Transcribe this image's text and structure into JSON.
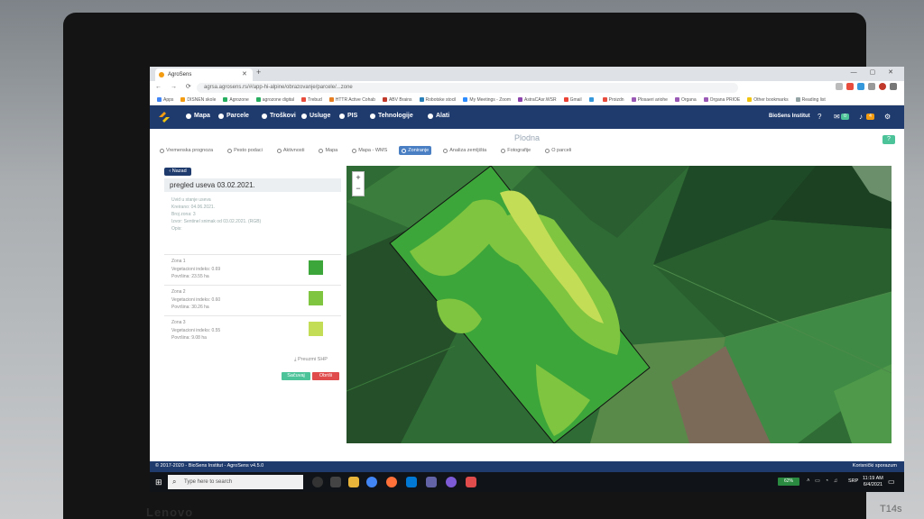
{
  "device": {
    "brand": "Lenovo",
    "model": "T14s"
  },
  "browser": {
    "tab_title": "AgroSens",
    "url": "agrsa.agrosens.rs/#/app-hi-alpine/obrazovanje/parcele/...zone",
    "bookmarks": [
      "Apps",
      "DISNEN skole",
      "Agrozone",
      "agrozone digital",
      "Trebud",
      "HTTR Active Cohab",
      "ABV Brains",
      "Robotske stocil",
      "My Meetings - Zoom",
      "AstraCAsr.WSR",
      "Gmail",
      "",
      "Proizdn",
      "Plosaeri ariohe",
      "Organa",
      "Organa PRIOE",
      "Other bookmarks",
      "Reading list"
    ]
  },
  "app": {
    "nav": [
      "Mapa",
      "Parcele",
      "Troškovi",
      "Usluge",
      "PIS",
      "Tehnologije",
      "Alati"
    ],
    "org": "BioSens Institut",
    "badges": [
      "0",
      "4"
    ],
    "page_title": "Plodna",
    "help": "?",
    "subtabs": [
      "Vremenska prognoza",
      "Pesto podaci",
      "Aktivnosti",
      "Mapa",
      "Mapa - WMS",
      "Zoniranje",
      "Analiza zemljišta",
      "Fotografije",
      "O parceli"
    ],
    "active_subtab": "Zoniranje",
    "back_label": "Nazad",
    "panel_title": "pregled useva 03.02.2021.",
    "info_lines": [
      "Uvid u stanje useva",
      "Kreirano: 04.06.2021.",
      "Broj zona: 3",
      "Izvor: Sentinel snimak od 03.02.2021. (RGB)",
      "Opis:"
    ],
    "zones": [
      {
        "name": "Zona 1",
        "vi": "Vegetacioni indeks: 0.69",
        "area": "Površina: 23.55 ha",
        "color": "#3da63a"
      },
      {
        "name": "Zona 2",
        "vi": "Vegetacioni indeks: 0.60",
        "area": "Površina: 30.26 ha",
        "color": "#7fc540"
      },
      {
        "name": "Zona 3",
        "vi": "Vegetacioni indeks: 0.55",
        "area": "Površina: 9.08 ha",
        "color": "#c3de56"
      }
    ],
    "export_label": "Preuzmi SHP",
    "save_label": "Sačuvaj",
    "delete_label": "Obriši",
    "zoom": [
      "+",
      "−"
    ],
    "footer_copyright": "© 2017-2020 - BioSens Institut - AgroSens v4.5.0",
    "footer_terms": "Korisnički sporazum"
  },
  "taskbar": {
    "search_placeholder": "Type here to search",
    "battery": "62%",
    "lang": "SRP",
    "time": "11:19 AM",
    "date": "6/4/2021"
  }
}
